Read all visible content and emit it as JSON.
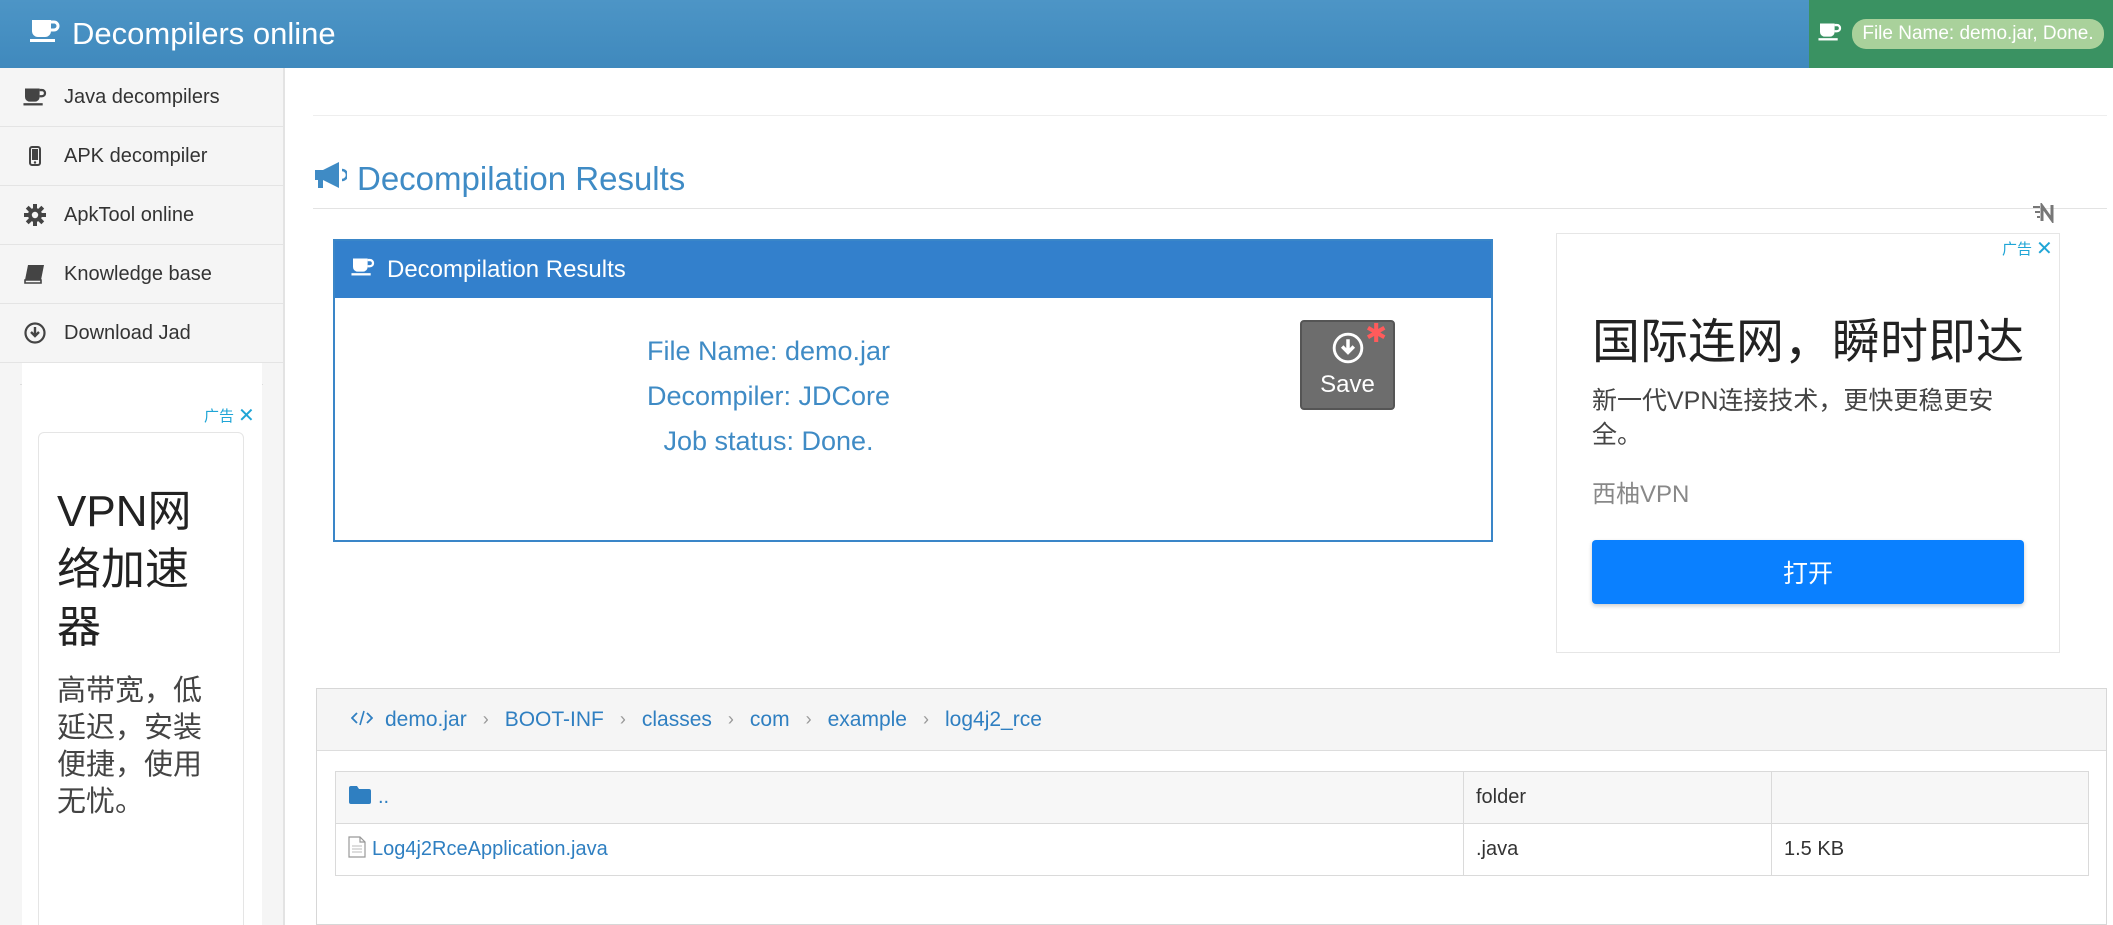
{
  "app": {
    "title": "Decompilers online"
  },
  "header_status": {
    "text": "File Name: demo.jar, Done."
  },
  "sidebar": {
    "items": [
      {
        "label": "Java decompilers",
        "icon": "coffee-cup-icon"
      },
      {
        "label": "APK decompiler",
        "icon": "mobile-phone-icon"
      },
      {
        "label": "ApkTool online",
        "icon": "gear-icon"
      },
      {
        "label": "Knowledge base",
        "icon": "book-icon"
      },
      {
        "label": "Download Jad",
        "icon": "download-circle-icon"
      }
    ],
    "collapse_glyph": "«",
    "ad": {
      "tag": "广告",
      "headline": "VPN网络加速器",
      "body": "高带宽，低延迟，安装便捷，使用无忧。"
    }
  },
  "main": {
    "section_title": "Decompilation Results",
    "panel": {
      "title": "Decompilation Results",
      "file_name": "File Name: demo.jar",
      "decompiler": "Decompiler: JDCore",
      "job_status": "Job status: Done.",
      "save_label": "Save"
    },
    "ad": {
      "tag": "广告",
      "headline": "国际连网，瞬时即达",
      "body": "新一代VPN连接技术，更快更稳更安全。",
      "source": "西柚VPN",
      "button": "打开"
    },
    "breadcrumb": [
      "demo.jar",
      "BOOT-INF",
      "classes",
      "com",
      "example",
      "log4j2_rce"
    ],
    "files": [
      {
        "name": "..",
        "type": "folder",
        "size": ""
      },
      {
        "name": "Log4j2RceApplication.java",
        "type": ".java",
        "size": "1.5 KB"
      }
    ]
  },
  "colors": {
    "header": "#4a90c2",
    "status_bg": "#3a9262",
    "accent": "#3380cc",
    "link": "#2f7fc1",
    "ad_button": "#0a80ff"
  }
}
